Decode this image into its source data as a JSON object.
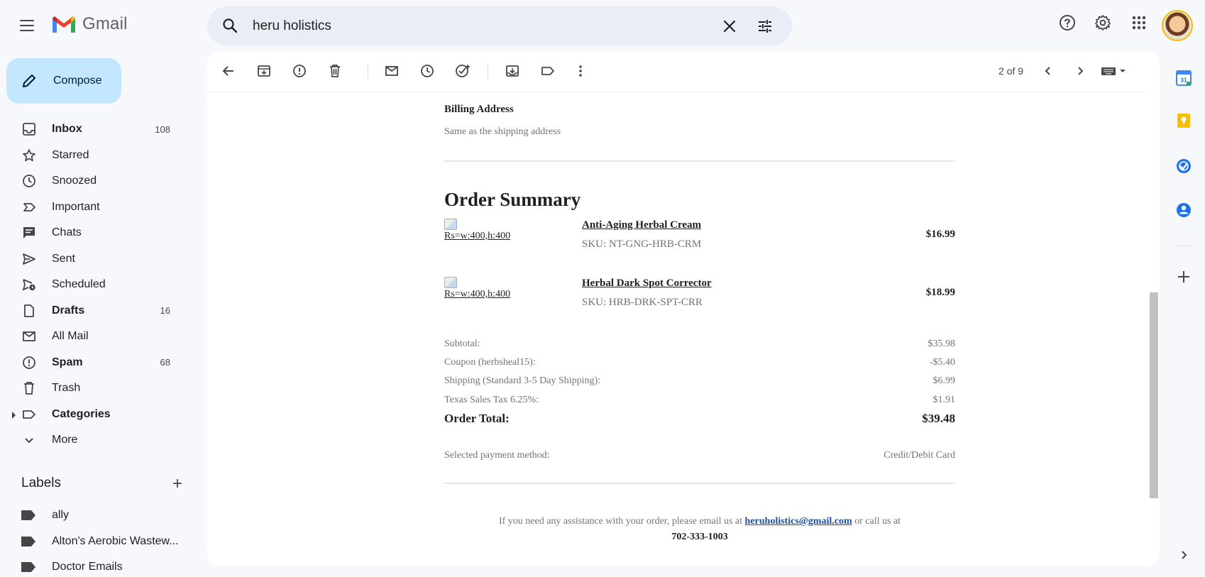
{
  "app": {
    "logo_text": "Gmail",
    "search_query": "heru holistics"
  },
  "compose": {
    "label": "Compose"
  },
  "nav": {
    "items": [
      {
        "label": "Inbox",
        "count": "108",
        "bold": true
      },
      {
        "label": "Starred",
        "count": ""
      },
      {
        "label": "Snoozed",
        "count": ""
      },
      {
        "label": "Important",
        "count": ""
      },
      {
        "label": "Chats",
        "count": ""
      },
      {
        "label": "Sent",
        "count": ""
      },
      {
        "label": "Scheduled",
        "count": ""
      },
      {
        "label": "Drafts",
        "count": "16",
        "bold": true
      },
      {
        "label": "All Mail",
        "count": ""
      },
      {
        "label": "Spam",
        "count": "68",
        "bold": true
      },
      {
        "label": "Trash",
        "count": ""
      },
      {
        "label": "Categories",
        "count": "",
        "bold": true
      },
      {
        "label": "More",
        "count": ""
      }
    ]
  },
  "labels": {
    "title": "Labels",
    "items": [
      {
        "label": "ally"
      },
      {
        "label": "Alton's Aerobic Wastew..."
      },
      {
        "label": "Doctor Emails"
      }
    ]
  },
  "toolbar": {
    "pager": "2 of 9"
  },
  "email": {
    "billing_title": "Billing Address",
    "billing_text": "Same as the shipping address",
    "order_title": "Order Summary",
    "items": [
      {
        "img_alt": "Rs=w:400,h:400",
        "name": "Anti-Aging Herbal Cream",
        "sku": "SKU: NT-GNG-HRB-CRM",
        "price": "$16.99"
      },
      {
        "img_alt": "Rs=w:400,h:400",
        "name": "Herbal Dark Spot Corrector",
        "sku": "SKU: HRB-DRK-SPT-CRR",
        "price": "$18.99"
      }
    ],
    "summary": [
      {
        "label": "Subtotal:",
        "value": "$35.98"
      },
      {
        "label": "Coupon (herbsheal15):",
        "value": "-$5.40"
      },
      {
        "label": "Shipping (Standard 3-5 Day Shipping):",
        "value": "$6.99"
      },
      {
        "label": "Texas Sales Tax 6.25%:",
        "value": "$1.91"
      }
    ],
    "total_label": "Order Total:",
    "total_value": "$39.48",
    "payment_label": "Selected payment method:",
    "payment_value": "Credit/Debit Card",
    "footer_before": "If you need any assistance with your order, please email us at ",
    "footer_email": "heruholistics@gmail.com",
    "footer_after": " or call us at",
    "footer_phone": "702-333-1003"
  },
  "sidepanel": {
    "calendar_day": "31"
  },
  "colors": {
    "background": "#f6f8fc",
    "compose": "#c2e7ff",
    "search": "#e9eef6",
    "link": "#1a4fa0"
  }
}
